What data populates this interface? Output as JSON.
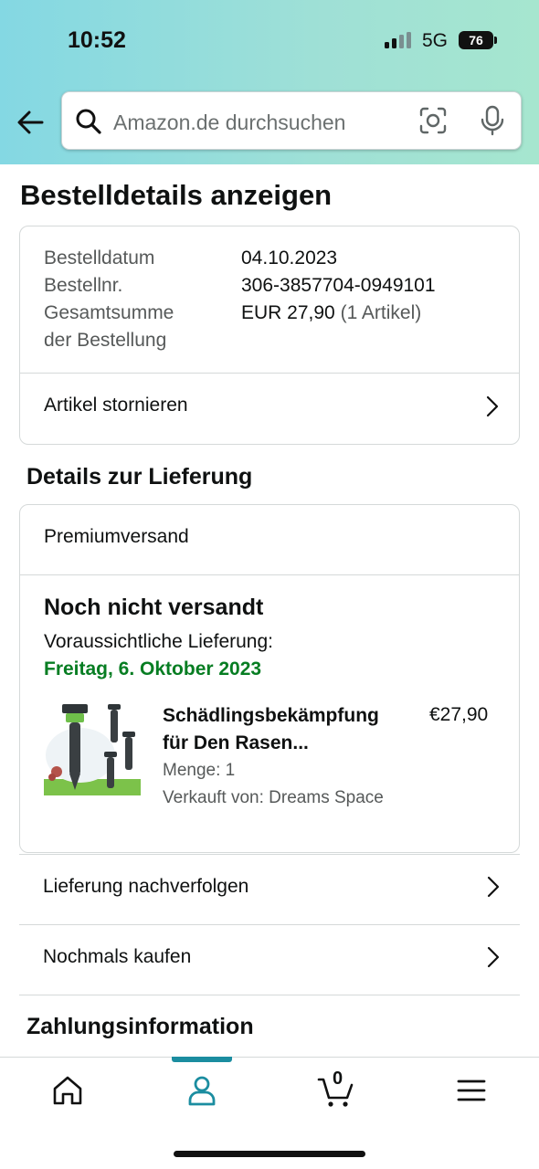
{
  "status_bar": {
    "time": "10:52",
    "network": "5G",
    "battery": "76"
  },
  "search": {
    "placeholder": "Amazon.de durchsuchen"
  },
  "page": {
    "title": "Bestelldetails anzeigen"
  },
  "order_summary": {
    "rows": [
      {
        "label": "Bestelldatum",
        "value": "04.10.2023"
      },
      {
        "label": "Bestellnr.",
        "value": "306-3857704-0949101"
      },
      {
        "label": "Gesamtsumme",
        "label_line2": "der Bestellung",
        "value": "EUR 27,90",
        "value_suffix": "(1 Artikel)"
      }
    ],
    "cancel_label": "Artikel stornieren"
  },
  "delivery": {
    "section_title": "Details zur Lieferung",
    "method": "Premiumversand",
    "status": "Noch nicht versandt",
    "expected_label": "Voraussichtliche Lieferung:",
    "expected_date": "Freitag, 6. Oktober 2023",
    "item": {
      "title_line1": "Schädlingsbekämpfung",
      "title_line2": "für Den Rasen...",
      "price": "€27,90",
      "quantity": "Menge: 1",
      "seller": "Verkauft von: Dreams Space"
    }
  },
  "actions": [
    {
      "label": "Lieferung nachverfolgen"
    },
    {
      "label": "Nochmals kaufen"
    }
  ],
  "payment": {
    "section_title": "Zahlungsinformation"
  },
  "tabbar": {
    "tabs": [
      "home-icon",
      "account-icon",
      "cart-icon",
      "menu-icon"
    ],
    "active": "account-icon",
    "cart_count": "0",
    "accent_color": "#1b8da0"
  },
  "colors": {
    "delivery_date": "#067d22",
    "header_gradient_start": "#84d8e3",
    "header_gradient_end": "#a6e6cf"
  }
}
